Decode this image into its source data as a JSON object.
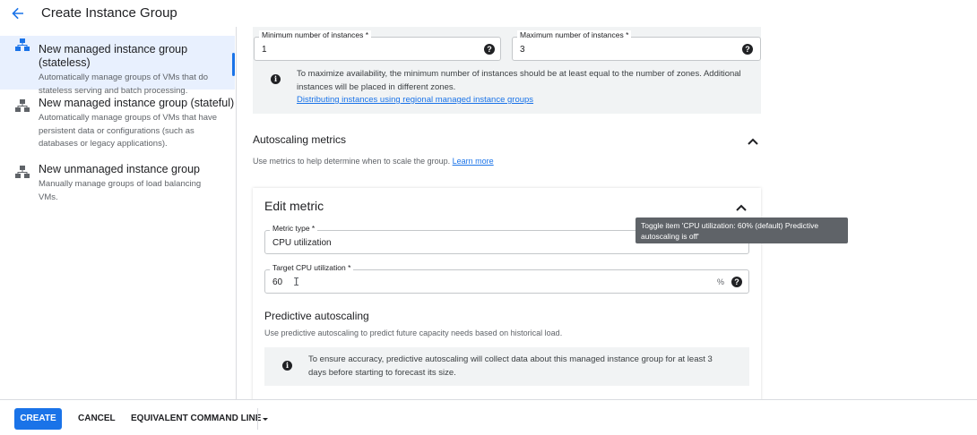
{
  "header": {
    "title": "Create Instance Group",
    "back_icon": "arrow-back-icon"
  },
  "sidebar": {
    "items": [
      {
        "title": "New managed instance group (stateless)",
        "description": [
          "Automatically manage groups of VMs that do",
          "stateless serving and batch processing."
        ],
        "icon": "instance-group-icon",
        "active": true
      },
      {
        "title": "New managed instance group (stateful)",
        "description": [
          "Automatically manage groups of VMs that have",
          "persistent data or configurations (such as",
          "databases or legacy applications)."
        ],
        "icon": "instance-group-icon",
        "active": false
      },
      {
        "title": "New unmanaged instance group",
        "description": [
          "Manually manage groups of load balancing",
          "VMs."
        ],
        "icon": "instance-group-icon",
        "active": false
      }
    ]
  },
  "instances": {
    "min_label": "Minimum number of instances *",
    "min_value": "1",
    "max_label": "Maximum number of instances *",
    "max_value": "3",
    "help_glyph": "?",
    "info_lines": [
      "To maximize availability, the minimum number of instances should be at least equal to the number of zones. Additional",
      "instances will be placed in different zones."
    ],
    "info_link": "Distributing instances using regional managed instance groups"
  },
  "autoscaling": {
    "title": "Autoscaling metrics",
    "description": "Use metrics to help determine when to scale the group.",
    "learn_more": "Learn more"
  },
  "edit_metric": {
    "title": "Edit metric",
    "metric_type_label": "Metric type *",
    "metric_type_value": "CPU utilization",
    "target_label": "Target CPU utilization *",
    "target_value": "60",
    "target_suffix": "%",
    "predictive_title": "Predictive autoscaling",
    "predictive_desc": "Use predictive autoscaling to predict future capacity needs based on historical load.",
    "predictive_info": [
      "To ensure accuracy, predictive autoscaling will collect data about this managed instance group for at least 3",
      "days before starting to forecast its size."
    ]
  },
  "tooltip": {
    "lines": [
      "Toggle item 'CPU utilization: 60% (default) Predictive",
      "autoscaling is off'"
    ]
  },
  "footer": {
    "create": "CREATE",
    "cancel": "CANCEL",
    "equivalent": "EQUIVALENT COMMAND LINE"
  },
  "colors": {
    "accent": "#1a73e8",
    "tooltip_bg": "#5f6368",
    "info_bg": "#f1f3f4",
    "active_item_bg": "#e8f0fe"
  }
}
